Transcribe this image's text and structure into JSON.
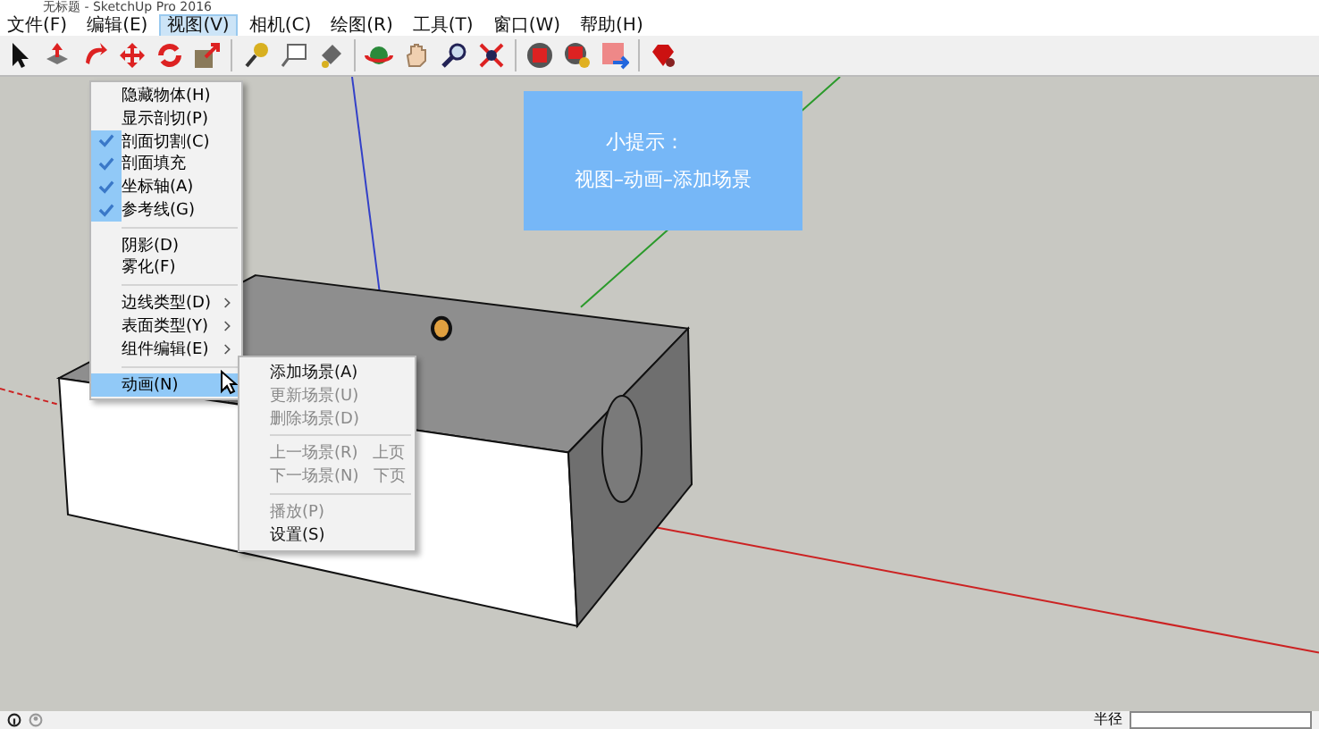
{
  "window": {
    "title": "无标题 - SketchUp Pro 2016"
  },
  "menu_bar": [
    {
      "label": "文件(F)",
      "selected": false
    },
    {
      "label": "编辑(E)",
      "selected": false
    },
    {
      "label": "视图(V)",
      "selected": true
    },
    {
      "label": "相机(C)",
      "selected": false
    },
    {
      "label": "绘图(R)",
      "selected": false
    },
    {
      "label": "工具(T)",
      "selected": false
    },
    {
      "label": "窗口(W)",
      "selected": false
    },
    {
      "label": "帮助(H)",
      "selected": false
    }
  ],
  "view_menu": [
    {
      "kind": "item",
      "label": "隐藏物体(H)",
      "checked": false,
      "submenu": false,
      "selected": false
    },
    {
      "kind": "item",
      "label": "显示剖切(P)",
      "checked": false,
      "submenu": false,
      "selected": false
    },
    {
      "kind": "item",
      "label": "剖面切割(C)",
      "checked": true,
      "submenu": false,
      "selected": false
    },
    {
      "kind": "item",
      "label": "剖面填充",
      "checked": true,
      "submenu": false,
      "selected": false
    },
    {
      "kind": "item",
      "label": "坐标轴(A)",
      "checked": true,
      "submenu": false,
      "selected": false
    },
    {
      "kind": "item",
      "label": "参考线(G)",
      "checked": true,
      "submenu": false,
      "selected": false
    },
    {
      "kind": "separator"
    },
    {
      "kind": "item",
      "label": "阴影(D)",
      "checked": false,
      "submenu": false,
      "selected": false
    },
    {
      "kind": "item",
      "label": "雾化(F)",
      "checked": false,
      "submenu": false,
      "selected": false
    },
    {
      "kind": "separator"
    },
    {
      "kind": "item",
      "label": "边线类型(D)",
      "checked": false,
      "submenu": true,
      "selected": false
    },
    {
      "kind": "item",
      "label": "表面类型(Y)",
      "checked": false,
      "submenu": true,
      "selected": false
    },
    {
      "kind": "item",
      "label": "组件编辑(E)",
      "checked": false,
      "submenu": true,
      "selected": false
    },
    {
      "kind": "separator"
    },
    {
      "kind": "item",
      "label": "动画(N)",
      "checked": false,
      "submenu": true,
      "selected": true
    }
  ],
  "animation_menu": [
    {
      "kind": "item",
      "label": "添加场景(A)",
      "disabled": false
    },
    {
      "kind": "item",
      "label": "更新场景(U)",
      "disabled": true
    },
    {
      "kind": "item",
      "label": "删除场景(D)",
      "disabled": true
    },
    {
      "kind": "separator"
    },
    {
      "kind": "item",
      "label": "上一场景(R)",
      "shortcut": "上页",
      "disabled": true
    },
    {
      "kind": "item",
      "label": "下一场景(N)",
      "shortcut": "下页",
      "disabled": true
    },
    {
      "kind": "separator"
    },
    {
      "kind": "item",
      "label": "播放(P)",
      "disabled": true
    },
    {
      "kind": "item",
      "label": "设置(S)",
      "disabled": false
    }
  ],
  "tip": {
    "title": "小提示：",
    "text": "视图–动画–添加场景"
  },
  "status_bar": {
    "field_label": "半径"
  }
}
